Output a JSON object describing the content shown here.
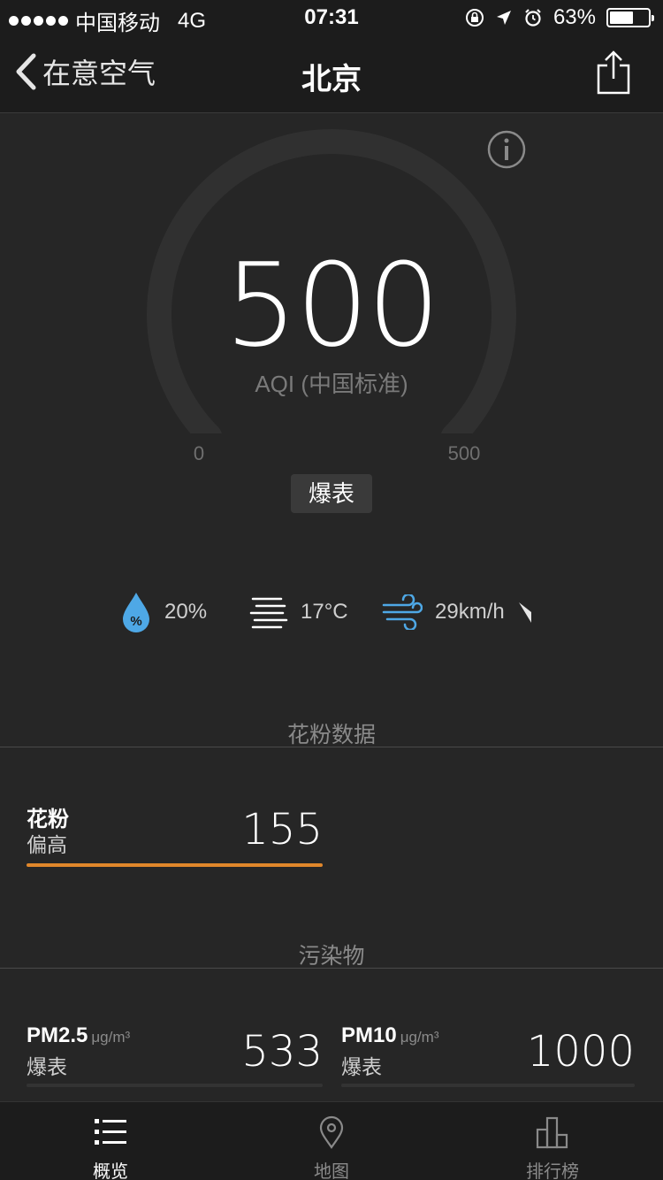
{
  "status_bar": {
    "carrier": "中国移动",
    "network": "4G",
    "time": "07:31",
    "battery_percent_text": "63%",
    "battery_level": 0.63
  },
  "nav": {
    "back_label": "在意空气",
    "title": "北京"
  },
  "aqi": {
    "value": "500",
    "label": "AQI (中国标准)",
    "scale_min": "0",
    "scale_max": "500",
    "level": "爆表",
    "fraction": 1.0,
    "track_color": "#303030"
  },
  "weather": {
    "humidity": "20%",
    "humidity_icon": "water-drop-percent-icon",
    "temperature": "17°C",
    "temperature_icon": "fog-lines-icon",
    "wind": "29km/h",
    "wind_icon": "wind-icon",
    "wind_direction_icon": "wind-direction-arrow-icon"
  },
  "pollen_section": {
    "title": "花粉数据",
    "card": {
      "name": "花粉",
      "level": "偏高",
      "value": "155",
      "bar_color": "#e0872b",
      "fraction": 1.0
    }
  },
  "pollutant_section": {
    "title": "污染物",
    "cards": [
      {
        "name": "PM2.5",
        "unit": "μg/m³",
        "level": "爆表",
        "value": "533"
      },
      {
        "name": "PM10",
        "unit": "μg/m³",
        "level": "爆表",
        "value": "1000"
      }
    ]
  },
  "tabs": [
    {
      "label": "概览",
      "icon": "list-icon",
      "active": true
    },
    {
      "label": "地图",
      "icon": "map-pin-icon",
      "active": false
    },
    {
      "label": "排行榜",
      "icon": "bar-chart-icon",
      "active": false
    }
  ]
}
